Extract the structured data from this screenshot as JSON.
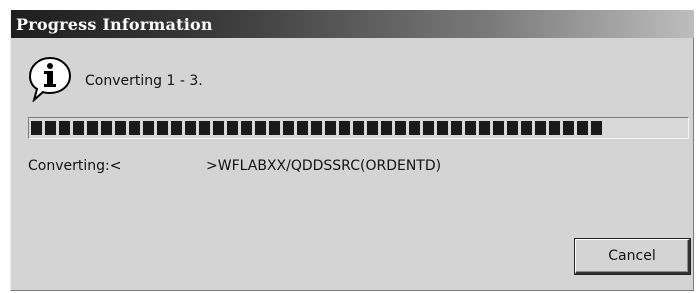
{
  "window": {
    "title": "Progress Information"
  },
  "message": {
    "icon": "info-icon",
    "text": "Converting 1 - 3."
  },
  "progress": {
    "fraction": 0.89
  },
  "status": {
    "label": "Converting:<",
    "value": ">WFLABXX/QDDSSRC(ORDENTD)"
  },
  "buttons": {
    "cancel_label": "Cancel"
  }
}
